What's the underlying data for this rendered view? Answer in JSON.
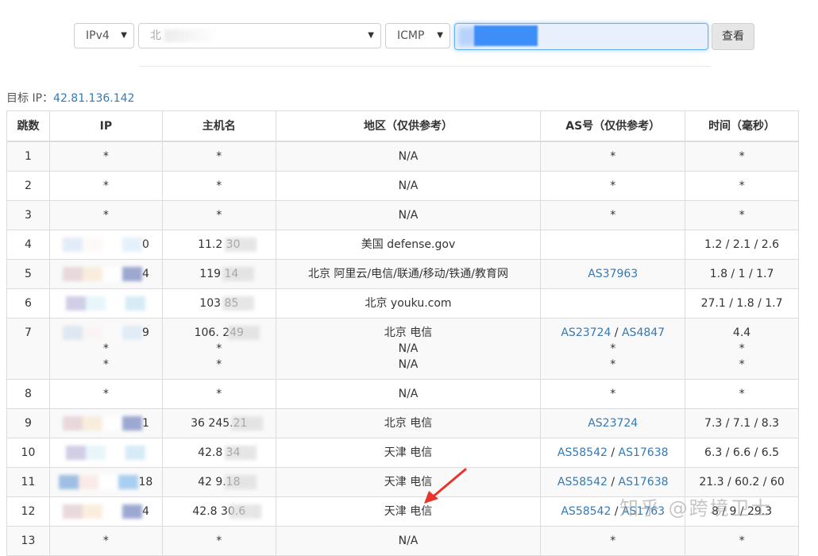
{
  "query": {
    "ip_version": "IPv4",
    "node_select": "北",
    "protocol": "ICMP",
    "target_input": "",
    "submit_label": "查看"
  },
  "target": {
    "label": "目标 IP：",
    "ip": "42.81.136.142"
  },
  "table": {
    "headers": [
      "跳数",
      "IP",
      "主机名",
      "地区（仅供参考）",
      "AS号（仅供参考）",
      "时间（毫秒）"
    ],
    "rows": [
      {
        "hop": "1",
        "ip": [
          "*"
        ],
        "host": [
          "*"
        ],
        "region": [
          "N/A"
        ],
        "as": [
          [
            {
              "t": "*",
              "link": false
            }
          ]
        ],
        "time": [
          "*"
        ]
      },
      {
        "hop": "2",
        "ip": [
          "*"
        ],
        "host": [
          "*"
        ],
        "region": [
          "N/A"
        ],
        "as": [
          [
            {
              "t": "*",
              "link": false
            }
          ]
        ],
        "time": [
          "*"
        ]
      },
      {
        "hop": "3",
        "ip": [
          "*"
        ],
        "host": [
          "*"
        ],
        "region": [
          "N/A"
        ],
        "as": [
          [
            {
              "t": "*",
              "link": false
            }
          ]
        ],
        "time": [
          "*"
        ]
      },
      {
        "hop": "4",
        "ip": [
          "0"
        ],
        "host": [
          "11.2 30"
        ],
        "region": [
          "美国 defense.gov"
        ],
        "as": [
          []
        ],
        "time": [
          "1.2 / 2.1 / 2.6"
        ]
      },
      {
        "hop": "5",
        "ip": [
          "4"
        ],
        "host": [
          "119 14"
        ],
        "region": [
          "北京 阿里云/电信/联通/移动/铁通/教育网"
        ],
        "as": [
          [
            {
              "t": "AS37963",
              "link": true
            }
          ]
        ],
        "time": [
          "1.8 / 1 / 1.7"
        ]
      },
      {
        "hop": "6",
        "ip": [
          ""
        ],
        "host": [
          "103 85"
        ],
        "region": [
          "北京 youku.com"
        ],
        "as": [
          []
        ],
        "time": [
          "27.1 / 1.8 / 1.7"
        ]
      },
      {
        "hop": "7",
        "ip": [
          "9",
          "*",
          "*"
        ],
        "host": [
          "106. 249",
          "*",
          "*"
        ],
        "region": [
          "北京 电信",
          "N/A",
          "N/A"
        ],
        "as": [
          [
            {
              "t": "AS23724",
              "link": true
            },
            {
              "t": " / ",
              "link": false
            },
            {
              "t": "AS4847",
              "link": true
            }
          ],
          [
            {
              "t": "*",
              "link": false
            }
          ],
          [
            {
              "t": "*",
              "link": false
            }
          ]
        ],
        "time": [
          "4.4",
          "*",
          "*"
        ]
      },
      {
        "hop": "8",
        "ip": [
          "*"
        ],
        "host": [
          "*"
        ],
        "region": [
          "N/A"
        ],
        "as": [
          [
            {
              "t": "*",
              "link": false
            }
          ]
        ],
        "time": [
          "*"
        ]
      },
      {
        "hop": "9",
        "ip": [
          "1"
        ],
        "host": [
          "36 245.21"
        ],
        "region": [
          "北京 电信"
        ],
        "as": [
          [
            {
              "t": "AS23724",
              "link": true
            }
          ]
        ],
        "time": [
          "7.3 / 7.1 / 8.3"
        ]
      },
      {
        "hop": "10",
        "ip": [
          ""
        ],
        "host": [
          "42.8 34"
        ],
        "region": [
          "天津 电信"
        ],
        "as": [
          [
            {
              "t": "AS58542",
              "link": true
            },
            {
              "t": " / ",
              "link": false
            },
            {
              "t": "AS17638",
              "link": true
            }
          ]
        ],
        "time": [
          "6.3 / 6.6 / 6.5"
        ]
      },
      {
        "hop": "11",
        "ip": [
          "18"
        ],
        "host": [
          "42 9.18"
        ],
        "region": [
          "天津 电信"
        ],
        "as": [
          [
            {
              "t": "AS58542",
              "link": true
            },
            {
              "t": " / ",
              "link": false
            },
            {
              "t": "AS17638",
              "link": true
            }
          ]
        ],
        "time": [
          "21.3 / 60.2 / 60"
        ]
      },
      {
        "hop": "12",
        "ip": [
          "4"
        ],
        "host": [
          "42.8 30.6"
        ],
        "region": [
          "天津 电信"
        ],
        "as": [
          [
            {
              "t": "AS58542",
              "link": true
            },
            {
              "t": " / ",
              "link": false
            },
            {
              "t": "AS1763",
              "link": true
            }
          ]
        ],
        "time": [
          "8 / 9 / 29.3"
        ]
      },
      {
        "hop": "13",
        "ip": [
          "*"
        ],
        "host": [
          "*"
        ],
        "region": [
          "N/A"
        ],
        "as": [
          [
            {
              "t": "*",
              "link": false
            }
          ]
        ],
        "time": [
          "*"
        ]
      }
    ]
  },
  "watermark": "知乎 @跨境卫士",
  "colors": {
    "link": "#337ab7",
    "focus_border": "#66afe9",
    "arrow": "#e8352b"
  }
}
